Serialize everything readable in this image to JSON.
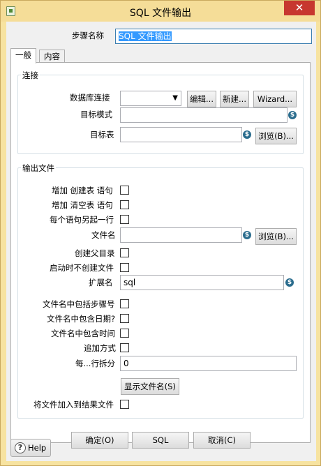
{
  "window": {
    "title": "SQL 文件输出",
    "close": "✕"
  },
  "step_name": {
    "label": "步骤名称",
    "value": "SQL 文件输出"
  },
  "tabs": [
    {
      "label": "一般"
    },
    {
      "label": "内容"
    }
  ],
  "connection": {
    "group_title": "连接",
    "db_label": "数据库连接",
    "db_value": "",
    "edit_btn": "编辑...",
    "new_btn": "新建...",
    "wizard_btn": "Wizard...",
    "schema_label": "目标模式",
    "schema_value": "",
    "table_label": "目标表",
    "table_value": "",
    "browse_btn": "浏览(B)..."
  },
  "output": {
    "group_title": "输出文件",
    "add_create_label": "增加 创建表 语句",
    "add_truncate_label": "增加 清空表 语句",
    "new_line_label": "每个语句另起一行",
    "filename_label": "文件名",
    "filename_value": "",
    "browse_btn": "浏览(B)...",
    "create_parent_label": "创建父目录",
    "no_create_at_start_label": "启动时不创建文件",
    "ext_label": "扩展名",
    "ext_value": "sql",
    "include_stepnr_label": "文件名中包括步骤号",
    "include_date_label": "文件名中包含日期?",
    "include_time_label": "文件名中包含时间",
    "append_label": "追加方式",
    "split_label": "每...行拆分",
    "split_value": "0",
    "show_files_btn": "显示文件名(S)",
    "add_to_result_label": "将文件加入到结果文件"
  },
  "footer": {
    "help": "Help",
    "ok": "确定(O)",
    "sql": "SQL",
    "cancel": "取消(C)"
  },
  "icons": {
    "variable": "$"
  }
}
